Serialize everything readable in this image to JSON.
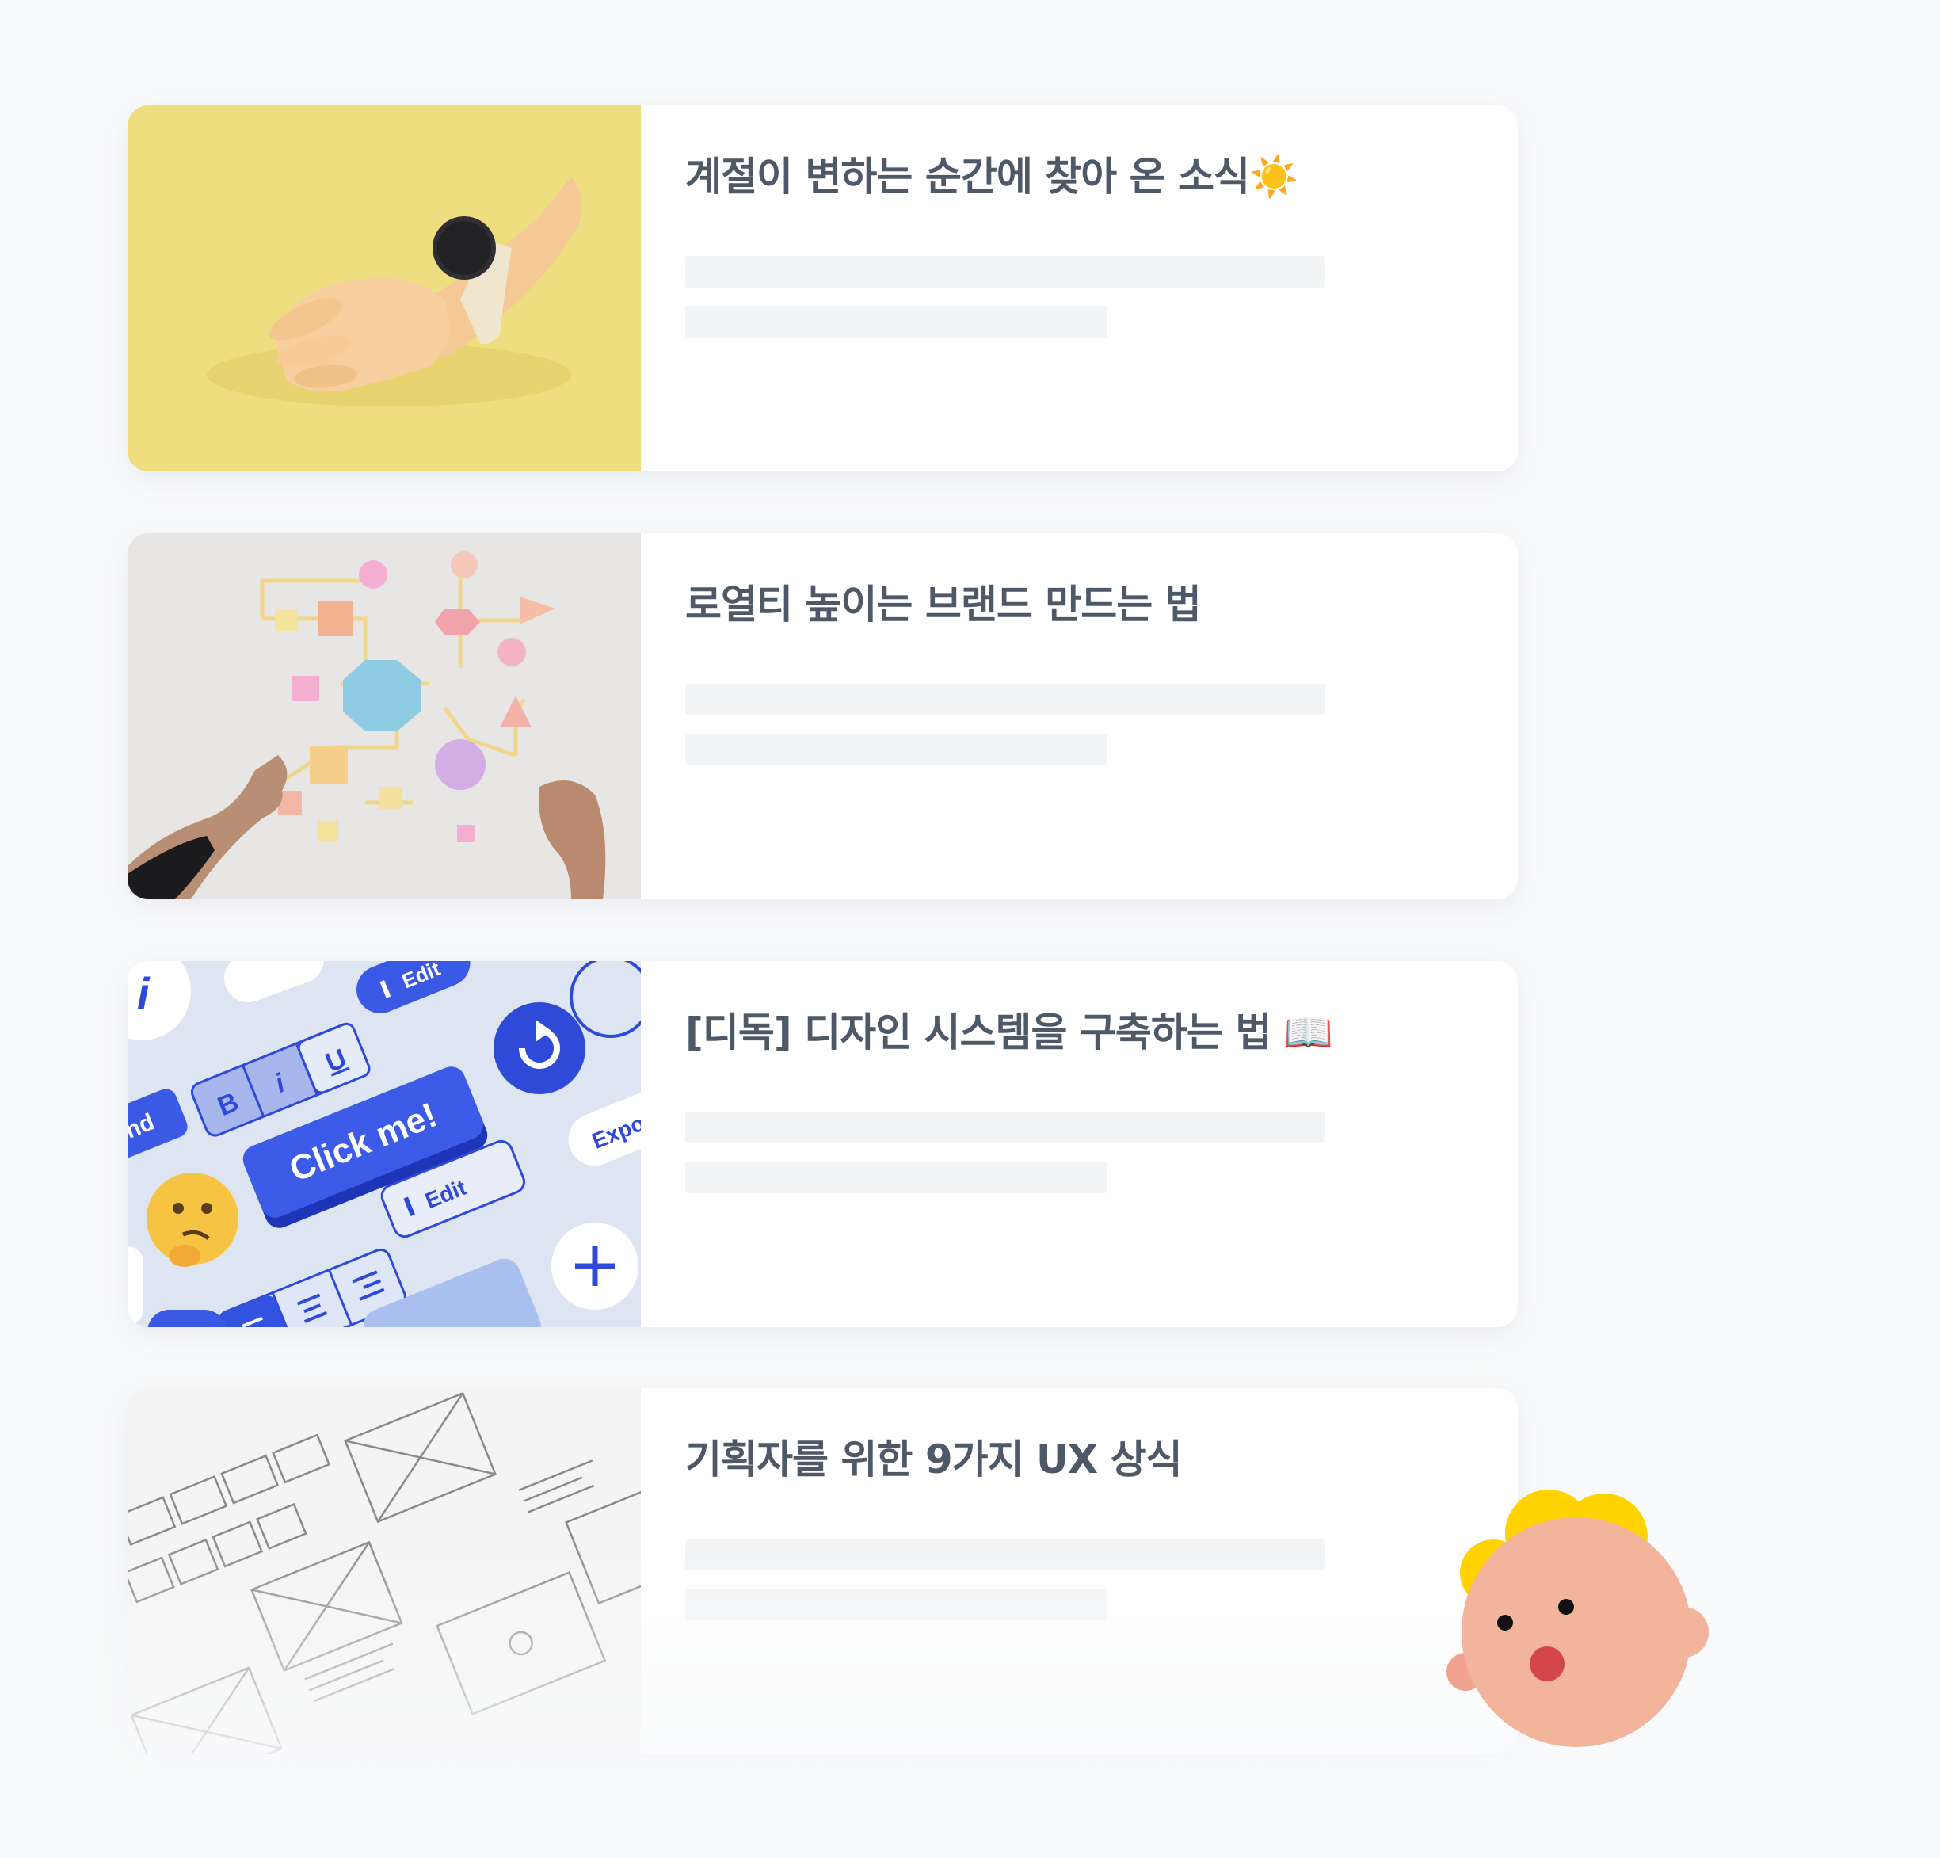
{
  "cards": [
    {
      "title": "계절이 변하는 순간에 찾아 온 소식",
      "emoji": "☀️",
      "thumbnail": "wrist-watch-photo"
    },
    {
      "title": "로열티 높이는 브랜드 만드는 법",
      "emoji": "",
      "thumbnail": "flowchart-shapes-photo"
    },
    {
      "title": "[디독] 디자인 시스템을 구축하는 법",
      "emoji": "📖",
      "thumbnail": "ui-components-illustration"
    },
    {
      "title": "기획자를 위한 9가지 UX 상식",
      "emoji": "",
      "thumbnail": "wireframe-sketch-photo"
    }
  ],
  "thumb3_labels": {
    "click": "Click me!",
    "edit_top": "Edit",
    "edit": "Edit",
    "bold": "B",
    "italic": "i",
    "underline": "U",
    "info": "i",
    "side_left": "nd",
    "side_right": "Expo"
  },
  "colors": {
    "background": "#f9fafb",
    "card": "#ffffff",
    "title": "#4e5968",
    "skeleton": "#f2f4f6",
    "accent_blue": "#3050e0",
    "mascot_skin": "#f3b49c",
    "mascot_hair": "#ffd200"
  }
}
